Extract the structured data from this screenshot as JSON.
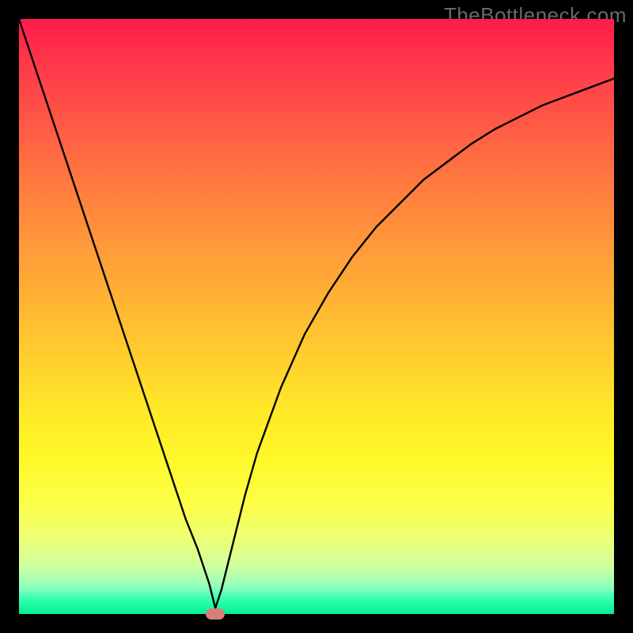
{
  "watermark": "TheBottleneck.com",
  "chart_data": {
    "type": "line",
    "title": "",
    "xlabel": "",
    "ylabel": "",
    "xlim": [
      0,
      100
    ],
    "ylim": [
      0,
      100
    ],
    "x": [
      0,
      2,
      4,
      6,
      8,
      10,
      12,
      14,
      16,
      18,
      20,
      22,
      24,
      26,
      28,
      30,
      32,
      33,
      34,
      36,
      38,
      40,
      44,
      48,
      52,
      56,
      60,
      64,
      68,
      72,
      76,
      80,
      84,
      88,
      92,
      96,
      100
    ],
    "values": [
      100,
      94,
      88,
      82,
      76,
      70,
      64,
      58,
      52,
      46,
      40,
      34,
      28,
      22,
      16,
      11,
      5,
      1,
      4,
      12,
      20,
      27,
      38,
      47,
      54,
      60,
      65,
      69,
      73,
      76,
      79,
      81.5,
      83.5,
      85.5,
      87,
      88.5,
      90
    ],
    "marker": {
      "x": 33,
      "y": 0
    },
    "gradient_stops": [
      {
        "pos": 0,
        "color": "#ff1a4b"
      },
      {
        "pos": 0.5,
        "color": "#ffd22d"
      },
      {
        "pos": 0.82,
        "color": "#fcff4a"
      },
      {
        "pos": 1.0,
        "color": "#00f191"
      }
    ]
  }
}
